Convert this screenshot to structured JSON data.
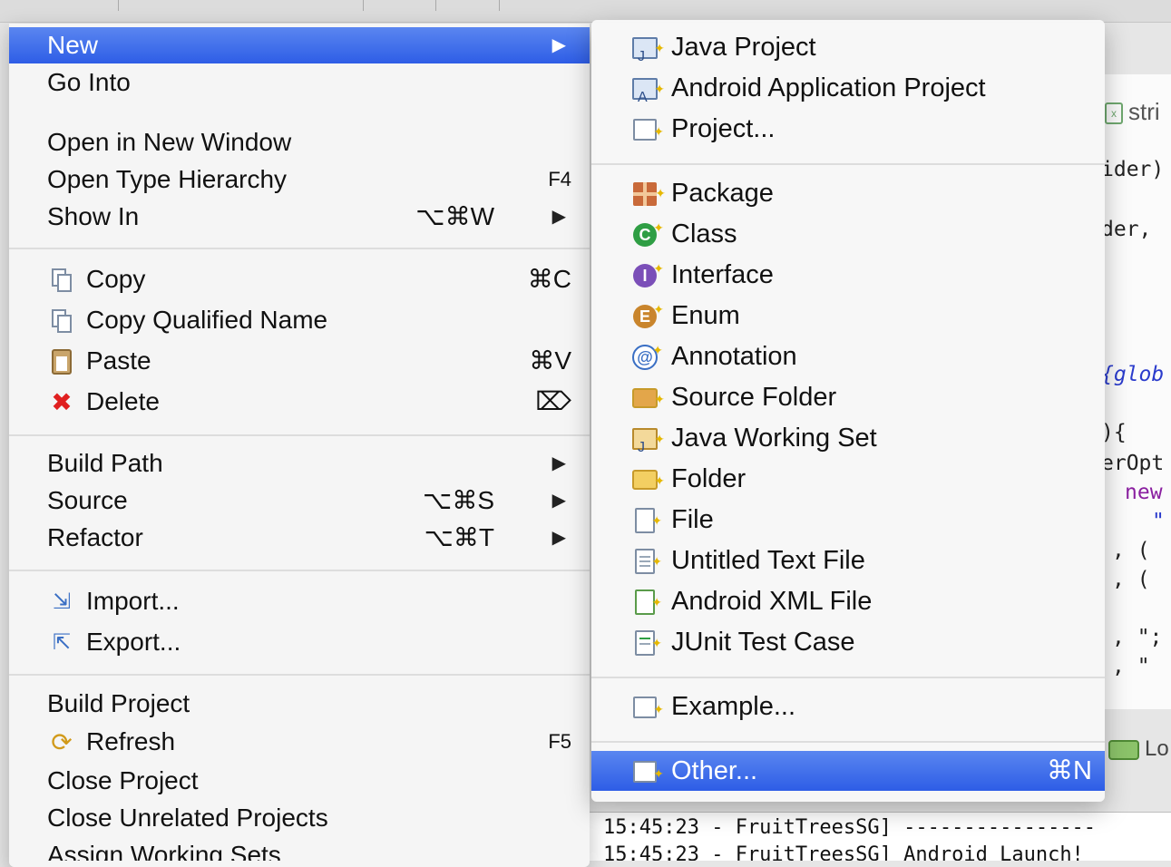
{
  "main_menu": {
    "items": [
      {
        "label": "New",
        "shortcut": "",
        "submenu": true,
        "selected": true
      },
      {
        "label": "Go Into",
        "shortcut": "",
        "submenu": false
      },
      {
        "label": "Open in New Window",
        "shortcut": "",
        "submenu": false
      },
      {
        "label": "Open Type Hierarchy",
        "shortcut": "F4",
        "submenu": false
      },
      {
        "label": "Show In",
        "shortcut": "⌥⌘W",
        "submenu": true
      },
      {
        "label": "Copy",
        "shortcut": "⌘C",
        "icon": "copy-icon"
      },
      {
        "label": "Copy Qualified Name",
        "shortcut": "",
        "icon": "copy-qualified-name-icon"
      },
      {
        "label": "Paste",
        "shortcut": "⌘V",
        "icon": "paste-icon"
      },
      {
        "label": "Delete",
        "shortcut": "⌦",
        "icon": "delete-icon"
      },
      {
        "label": "Build Path",
        "shortcut": "",
        "submenu": true
      },
      {
        "label": "Source",
        "shortcut": "⌥⌘S",
        "submenu": true
      },
      {
        "label": "Refactor",
        "shortcut": "⌥⌘T",
        "submenu": true
      },
      {
        "label": "Import...",
        "shortcut": "",
        "icon": "import-icon"
      },
      {
        "label": "Export...",
        "shortcut": "",
        "icon": "export-icon"
      },
      {
        "label": "Build Project",
        "shortcut": ""
      },
      {
        "label": "Refresh",
        "shortcut": "F5",
        "icon": "refresh-icon"
      },
      {
        "label": "Close Project",
        "shortcut": ""
      },
      {
        "label": "Close Unrelated Projects",
        "shortcut": ""
      },
      {
        "label": "Assign Working Sets...",
        "shortcut": ""
      }
    ],
    "submenu_arrow": "▶"
  },
  "new_submenu": {
    "items": [
      {
        "label": "Java Project",
        "icon": "java-project-icon"
      },
      {
        "label": "Android Application Project",
        "icon": "android-project-icon"
      },
      {
        "label": "Project...",
        "icon": "project-icon"
      },
      {
        "label": "Package",
        "icon": "package-icon"
      },
      {
        "label": "Class",
        "icon": "class-icon"
      },
      {
        "label": "Interface",
        "icon": "interface-icon"
      },
      {
        "label": "Enum",
        "icon": "enum-icon"
      },
      {
        "label": "Annotation",
        "icon": "annotation-icon"
      },
      {
        "label": "Source Folder",
        "icon": "source-folder-icon"
      },
      {
        "label": "Java Working Set",
        "icon": "java-working-set-icon"
      },
      {
        "label": "Folder",
        "icon": "folder-icon"
      },
      {
        "label": "File",
        "icon": "file-icon"
      },
      {
        "label": "Untitled Text File",
        "icon": "text-file-icon"
      },
      {
        "label": "Android XML File",
        "icon": "android-xml-file-icon"
      },
      {
        "label": "JUnit Test Case",
        "icon": "junit-icon"
      },
      {
        "label": "Example...",
        "icon": "example-icon"
      },
      {
        "label": "Other...",
        "icon": "other-icon",
        "shortcut": "⌘N",
        "selected": true
      }
    ]
  },
  "background": {
    "editor_tab": "stri",
    "code_lines": [
      "ider)",
      "der,  ",
      "{glob",
      "){",
      "erOpt",
      "new",
      "\"",
      ", (",
      ", (",
      ", \";",
      ", \""
    ],
    "console_lines": [
      "15:45:23 - FruitTreesSG] ----------------",
      "15:45:23 - FruitTreesSG] Android Launch!"
    ],
    "logcat_label": "Lo"
  },
  "colors": {
    "selection_top": "#5a86f0",
    "selection_bottom": "#2e5de6",
    "class_icon": "#2f9e44",
    "interface_icon": "#7b4fb8",
    "enum_icon": "#c9852c",
    "annotation_icon": "#3a6fc4"
  }
}
